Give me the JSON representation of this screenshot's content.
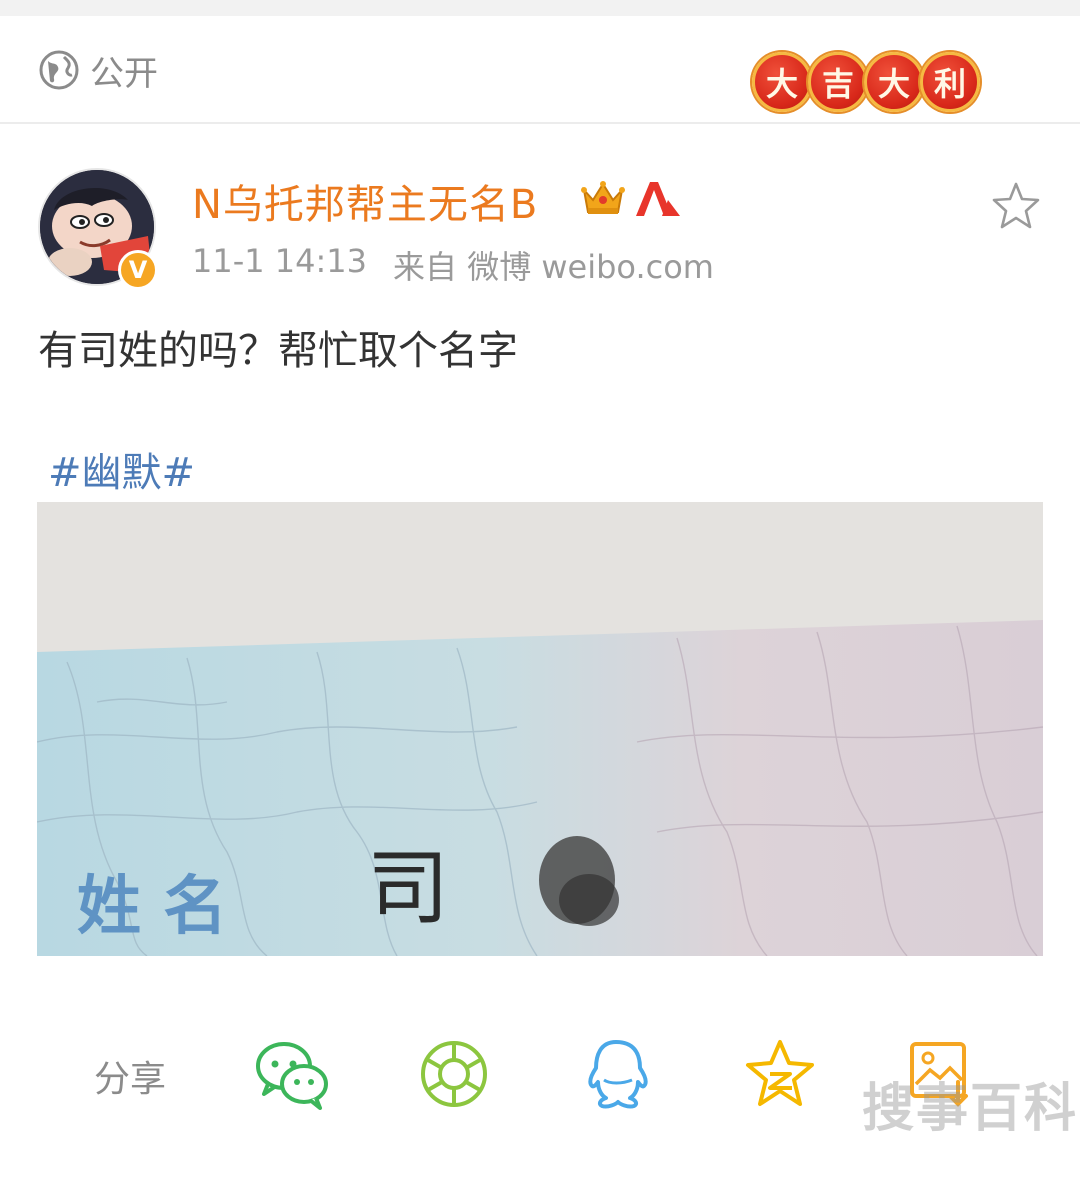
{
  "header": {
    "visibility_label": "公开",
    "visibility_icon": "globe-icon",
    "festival_badge": [
      "大",
      "吉",
      "大",
      "利"
    ]
  },
  "post": {
    "author_name": "N乌托邦帮主无名B",
    "verified_badge": "V",
    "time": "11-1 14:13",
    "source": "来自 微博 weibo.com",
    "text": "有司姓的吗？帮忙取个名字",
    "hashtag": "#幽默#",
    "photo_label_name": "姓 名",
    "photo_surname": "司"
  },
  "share_bar": {
    "label": "分享",
    "targets": [
      "wechat-icon",
      "moments-icon",
      "qq-icon",
      "qzone-icon",
      "save-image-icon"
    ]
  },
  "watermark": "搜事百科",
  "colors": {
    "author_name": "#eb7a1f",
    "hashtag": "#4d7bb7",
    "wechat": "#3cb65a",
    "moments": "#8cc63f",
    "qq": "#4aa8e8",
    "qzone": "#f5b800",
    "save": "#f5a623"
  }
}
